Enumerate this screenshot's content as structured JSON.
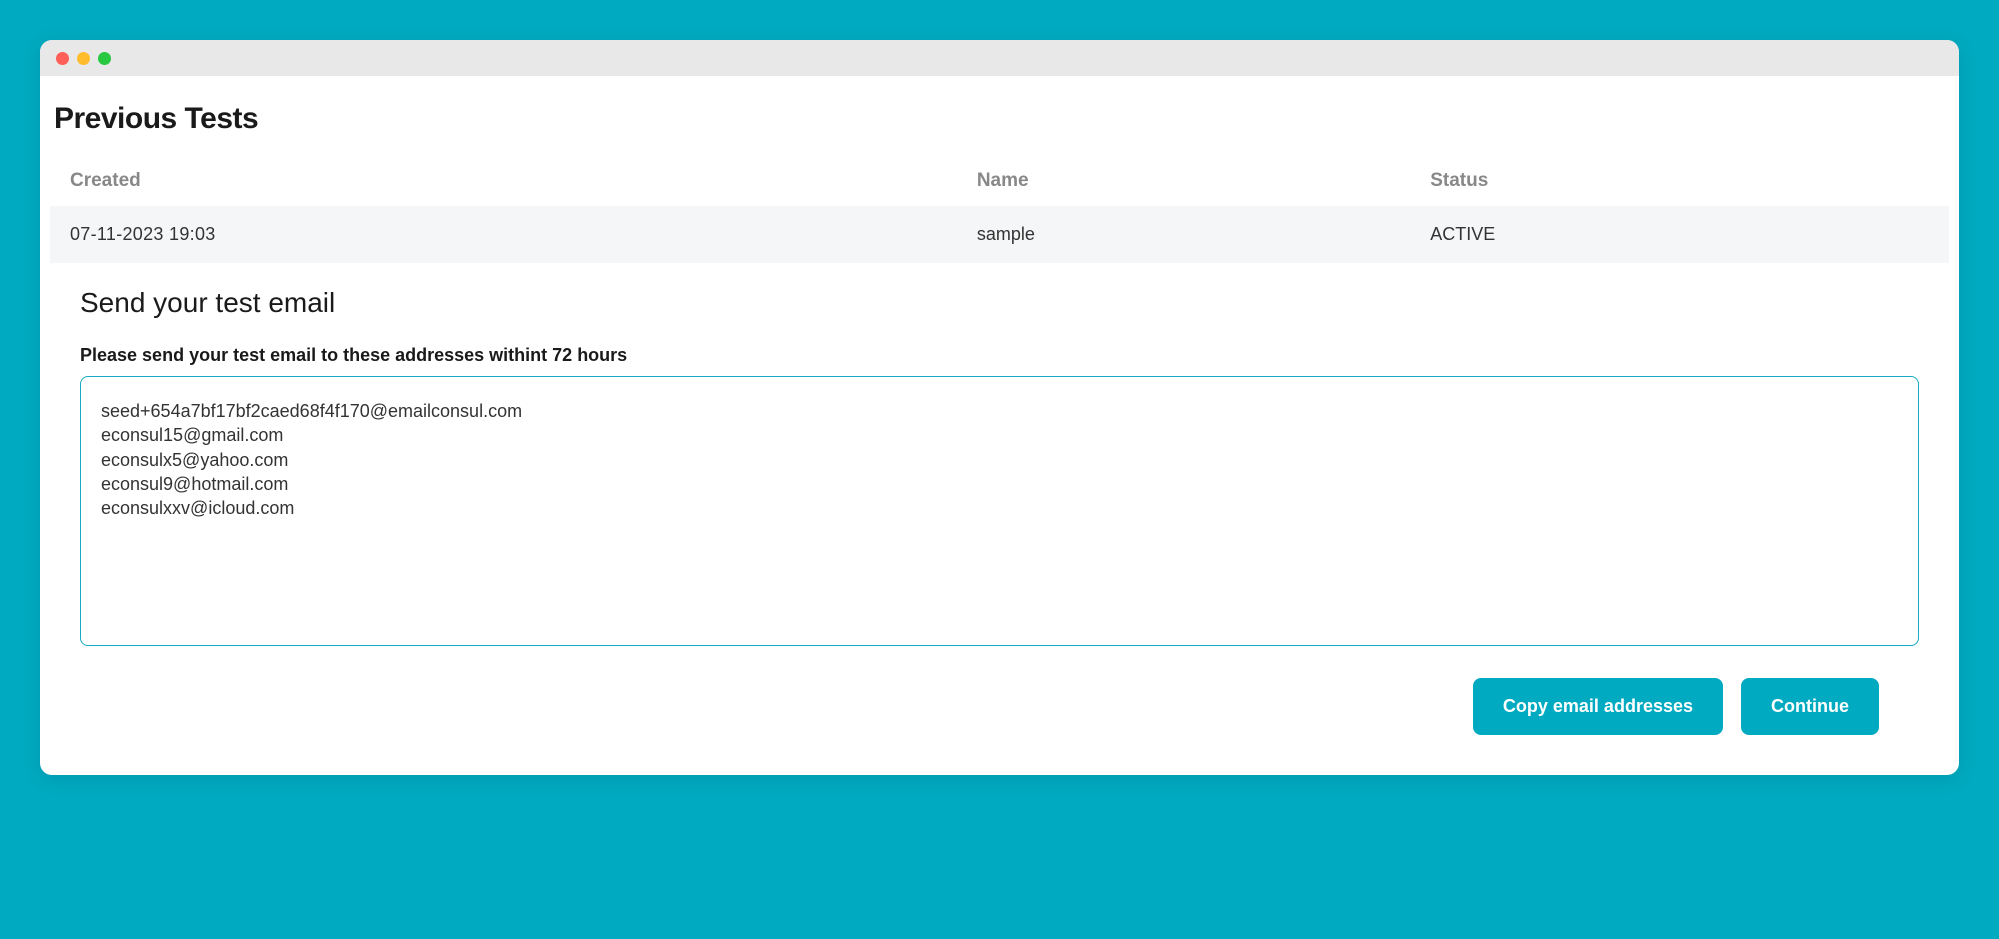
{
  "page_title": "Previous Tests",
  "table": {
    "headers": {
      "created": "Created",
      "name": "Name",
      "status": "Status"
    },
    "rows": [
      {
        "created": "07-11-2023 19:03",
        "name": "sample",
        "status": "ACTIVE"
      }
    ]
  },
  "section": {
    "title": "Send your test email",
    "instruction": "Please send your test email to these addresses withint 72 hours",
    "emails": "seed+654a7bf17bf2caed68f4f170@emailconsul.com\neconsul15@gmail.com\neconsulx5@yahoo.com\neconsul9@hotmail.com\neconsulxxv@icloud.com"
  },
  "buttons": {
    "copy": "Copy email addresses",
    "continue": "Continue"
  }
}
